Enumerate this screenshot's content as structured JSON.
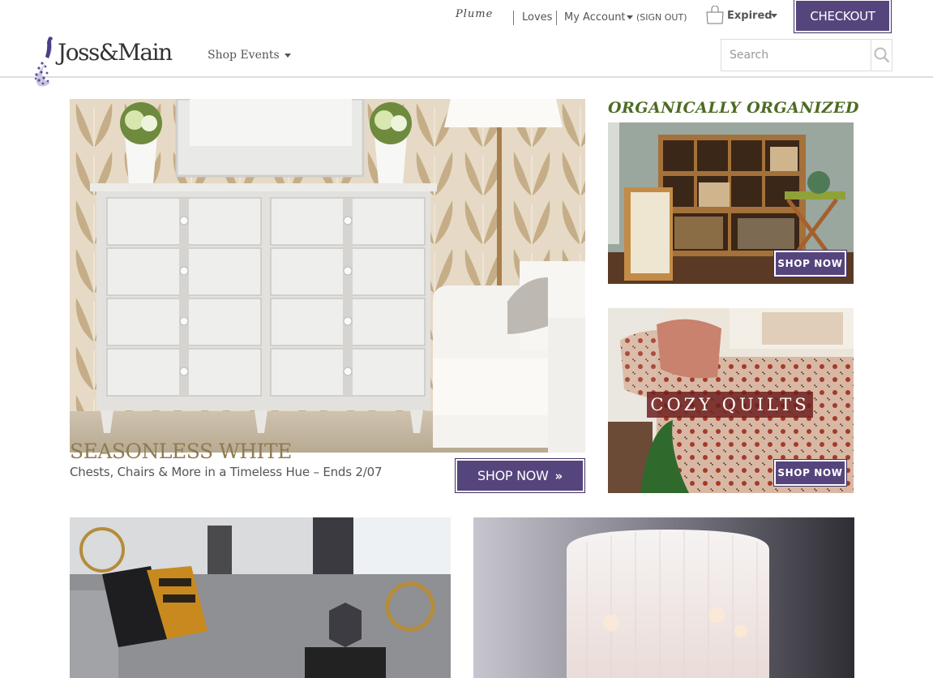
{
  "header": {
    "partner_logo": "Plume",
    "links": {
      "loves": "Loves",
      "my_account": "My Account",
      "sign_out": "(SIGN OUT)"
    },
    "cart": {
      "icon": "shopping-bag-icon",
      "status": "Expired"
    },
    "checkout_label": "CHECKOUT",
    "brand": "Joss&Main",
    "brand_icon": "peacock-logo-icon",
    "nav": {
      "shop_events": "Shop Events"
    },
    "search": {
      "placeholder": "Search",
      "value": "",
      "icon": "search-icon"
    }
  },
  "hero": {
    "image_alt": "White chest of drawers and white armchair against leaf-patterned wallpaper",
    "title": "SEASONLESS WHITE",
    "subtitle": "Chests, Chairs & More in a Timeless Hue – Ends 2/07",
    "cta_label": "SHOP NOW",
    "cta_icon": "double-chevron-right-icon"
  },
  "promos": [
    {
      "heading": "ORGANICALLY ORGANIZED",
      "image_alt": "Wooden cubby bookcase with baskets, hamper and folding side table",
      "cta_label": "SHOP NOW"
    },
    {
      "overlay_label": "COZY QUILTS",
      "image_alt": "Patterned quilt and pillows on a bed",
      "cta_label": "SHOP NOW"
    }
  ],
  "tiles": [
    {
      "image_alt": "Grey sofa with black and gold pillows and gold orb decor"
    },
    {
      "image_alt": "White string chandelier shade against damask wallpaper"
    }
  ],
  "colors": {
    "brand_purple": "#56457c",
    "hero_title_gold": "#8f7b52",
    "promo_green": "#4e6b24",
    "quilt_label_red": "#6e1e1e"
  }
}
